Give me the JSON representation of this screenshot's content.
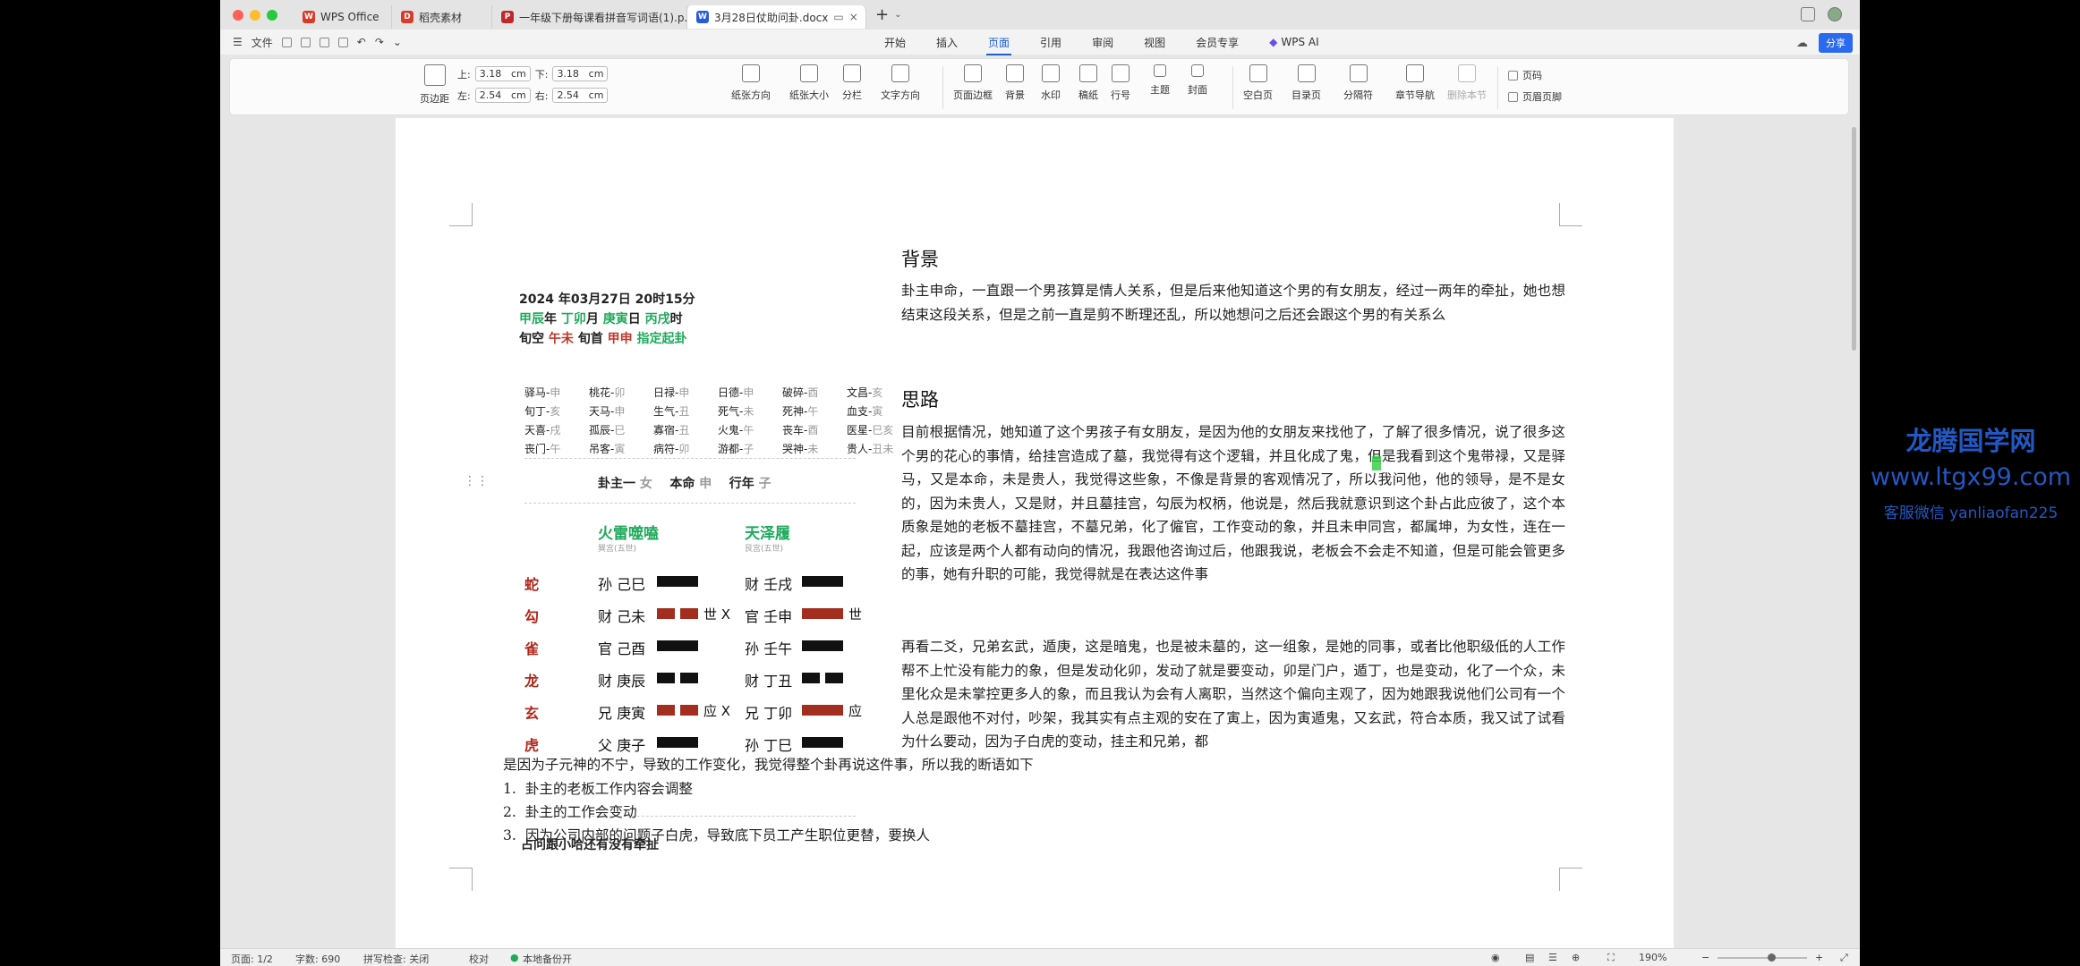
{
  "tabs": [
    {
      "label": "WPS Office",
      "icon": "W",
      "color": "#d93b2b"
    },
    {
      "label": "稻壳素材",
      "icon": "D",
      "color": "#d93b2b"
    },
    {
      "label": "一年级下册每课看拼音写词语(1).p...",
      "icon": "P",
      "color": "#c0282b"
    },
    {
      "label": "3月28日仗助问卦.docx",
      "icon": "W",
      "color": "#2a5bd7"
    }
  ],
  "menu": {
    "file": "文件",
    "tabs": [
      "开始",
      "插入",
      "页面",
      "引用",
      "审阅",
      "视图",
      "会员专享"
    ],
    "active": "页面",
    "ai": "WPS AI",
    "share": "分享"
  },
  "ribbon": {
    "margins": {
      "top_label": "上:",
      "top": "3.18",
      "bottom_label": "下:",
      "bottom": "3.18",
      "left_label": "左:",
      "left": "2.54",
      "right_label": "右:",
      "right": "2.54",
      "unit": "cm"
    },
    "margin_btn": "页边距",
    "groups": [
      "纸张方向",
      "纸张大小",
      "分栏",
      "文字方向",
      "页面边框",
      "背景",
      "水印",
      "稿纸",
      "行号",
      "主题",
      "封面",
      "空白页",
      "目录页",
      "分隔符",
      "章节导航",
      "删除本节"
    ],
    "header_footer": [
      "页码",
      "页眉页脚"
    ]
  },
  "chart": {
    "date": "2024 年03月27日 20时15分",
    "ganzhi": [
      "甲辰",
      "年 ",
      "丁卯",
      "月 ",
      "庚寅",
      "日 ",
      "丙戌",
      "时"
    ],
    "xunkong": [
      "旬空",
      "午未",
      "旬首",
      "甲申",
      "指定起卦"
    ],
    "shensha": [
      [
        "驿马-",
        "申",
        "桃花-",
        "卯",
        "日禄-",
        "申",
        "日德-",
        "申",
        "破碎-",
        "酉",
        "文昌-",
        "亥"
      ],
      [
        "旬丁-",
        "亥",
        "天马-",
        "申",
        "生气-",
        "丑",
        "死气-",
        "未",
        "死神-",
        "午",
        "血支-",
        "寅"
      ],
      [
        "天喜-",
        "戌",
        "孤辰-",
        "巳",
        "寡宿-",
        "丑",
        "火鬼-",
        "午",
        "丧车-",
        "酉",
        "医星-",
        "巳亥"
      ],
      [
        "丧门-",
        "午",
        "吊客-",
        "寅",
        "病符-",
        "卯",
        "游都-",
        "子",
        "哭神-",
        "未",
        "贵人-",
        "丑未"
      ]
    ],
    "gua_labels": [
      "卦主一",
      "女",
      "本命",
      "申",
      "行年",
      "子"
    ],
    "gua_main": "火雷噬嗑",
    "gua_main_sub": "巽宫(五世)",
    "gua_change": "天泽履",
    "gua_change_sub": "艮宫(五世)",
    "gods": [
      "蛇",
      "勾",
      "雀",
      "龙",
      "玄",
      "虎"
    ],
    "left_lines": [
      "孙 己巳",
      "财 己未",
      "官 己酉",
      "财 庚辰",
      "兄 庚寅",
      "父 庚子"
    ],
    "left_tail": [
      "",
      "世 X",
      "",
      "",
      "应 X",
      ""
    ],
    "right_lines": [
      "财 壬戌",
      "官 壬申",
      "孙 壬午",
      "财 丁丑",
      "兄 丁卯",
      "孙 丁巳"
    ],
    "right_tail": [
      "",
      "世",
      "",
      "",
      "应",
      ""
    ],
    "question": "占问跟小哈还有没有牵扯"
  },
  "doc": {
    "h1": "背景",
    "p1": "卦主申命，一直跟一个男孩算是情人关系，但是后来他知道这个男的有女朋友，经过一两年的牵扯，她也想结束这段关系，但是之前一直是剪不断理还乱，所以她想问之后还会跟这个男的有关系么",
    "h2": "思路",
    "p2": "目前根据情况，她知道了这个男孩子有女朋友，是因为他的女朋友来找他了，了解了很多情况，说了很多这个男的花心的事情，给挂宫造成了墓，我觉得有这个逻辑，并且化成了鬼，但是我看到这个鬼带禄，又是驿马，又是本命，未是贵人，我觉得这些象，不像是背景的客观情况了，所以我问他，他的领导，是不是女的，因为未贵人，又是财，并且墓挂宫，勾辰为权柄，他说是，然后我就意识到这个卦占此应彼了，这个本质象是她的老板不墓挂宫，不墓兄弟，化了僱官，工作变动的象，并且未申同宫，都属坤，为女性，连在一起，应该是两个人都有动向的情况，我跟他咨询过后，他跟我说，老板会不会走不知道，但是可能会管更多的事，她有升职的可能，我觉得就是在表达这件事",
    "p3": "再看二爻，兄弟玄武，遁庚，这是暗鬼，也是被未墓的，这一组象，是她的同事，或者比他职级低的人工作帮不上忙没有能力的象，但是发动化卯，发动了就是要变动，卯是门户，遁丁，也是变动，化了一个众，未里化众是未掌控更多人的象，而且我认为会有人离职，当然这个偏向主观了，因为她跟我说他们公司有一个人总是跟他不对付，吵架，我其实有点主观的安在了寅上，因为寅遁鬼，又玄武，符合本质，我又试了试看为什么要动，因为子白虎的变动，挂主和兄弟，都",
    "p3b": "是因为子元神的不宁，导致的工作变化，我觉得整个卦再说这件事，所以我的断语如下",
    "list": [
      "1.",
      "卦主的老板工作内容会调整",
      "2.",
      "卦主的工作会变动",
      "3.",
      "因为公司内部的问题子白虎，导致底下员工产生职位更替，要换人"
    ]
  },
  "status": {
    "page": "页面: 1/2",
    "words": "字数: 690",
    "spell": "拼写检查: 关闭",
    "proof": "校对",
    "backup": "本地备份开",
    "zoom": "190%"
  },
  "watermark": [
    "龙腾国学网",
    "www.ltgx99.com",
    "客服微信 yanliaofan225"
  ]
}
